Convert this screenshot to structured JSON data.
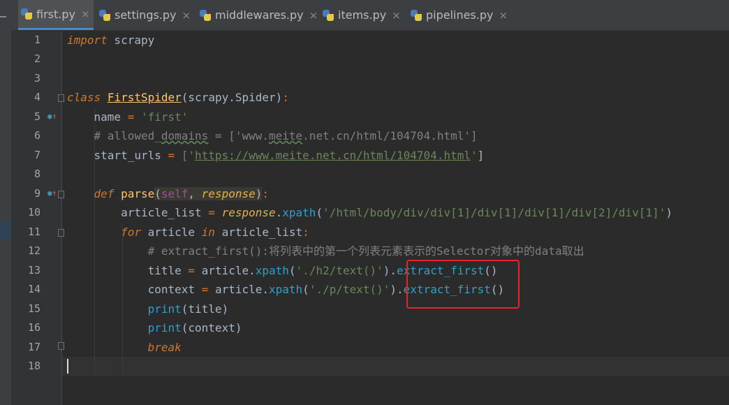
{
  "tabs": [
    {
      "label": "first.py",
      "active": true
    },
    {
      "label": "settings.py",
      "active": false
    },
    {
      "label": "middlewares.py",
      "active": false
    },
    {
      "label": "items.py",
      "active": false
    },
    {
      "label": "pipelines.py",
      "active": false
    }
  ],
  "close_glyph": "×",
  "line_numbers": [
    "1",
    "2",
    "3",
    "4",
    "5",
    "6",
    "7",
    "8",
    "9",
    "10",
    "11",
    "12",
    "13",
    "14",
    "15",
    "16",
    "17",
    "18"
  ],
  "current_line": 18,
  "colors": {
    "keyword": "#cc7832",
    "string": "#6a8759",
    "comment": "#808080",
    "highlight_box": "#e8242a",
    "method": "#2fa0c8"
  },
  "code": {
    "l1": {
      "kw": "import",
      "rest": " scrapy"
    },
    "l4": {
      "kw": "class",
      "name": "FirstSpider",
      "base": "(scrapy.Spider)",
      "colon": ":"
    },
    "l5": {
      "var": "name",
      "eq": " = ",
      "str": "'first'"
    },
    "l6": {
      "comment_pre": "# allowed_",
      "comment_wavy": "domains",
      "comment_mid": " = ['www.",
      "comment_wavy2": "meite",
      "comment_post": ".net.cn/html/104704.html']"
    },
    "l7": {
      "var": "start_urls",
      "eq": " = ",
      "open": "['",
      "url": "https://www.meite.net.cn/html/104704.html",
      "close_str": "'",
      "close": "]"
    },
    "l9": {
      "kw": "def",
      "name": " parse",
      "open": "(",
      "self": "self",
      "comma": ", ",
      "param": "response",
      "close": ")",
      "colon": ":"
    },
    "l10": {
      "var": "article_list",
      "eq": " = ",
      "obj": "response",
      "dot": ".",
      "meth": "xpath",
      "open": "(",
      "str": "'/html/body/div/div[1]/div[1]/div[1]/div[2]/div[1]'",
      "close": ")"
    },
    "l11": {
      "kw": "for",
      "var": " article ",
      "kw2": "in",
      "rest": " article_list",
      "colon": ":"
    },
    "l12": {
      "comment": "# extract_first():将列表中的第一个列表元素表示的Selector对象中的data取出"
    },
    "l13": {
      "var": "title",
      "eq": " = ",
      "obj": "article.",
      "meth": "xpath",
      "open": "(",
      "str": "'./h2/text()'",
      "close": ").",
      "meth2": "extract_first",
      "end": "()"
    },
    "l14": {
      "var": "context",
      "eq": " = ",
      "obj": "article.",
      "meth": "xpath",
      "open": "(",
      "str": "'./p/text()'",
      "close": ").",
      "meth2": "extract_first",
      "end": "()"
    },
    "l15": {
      "fn": "print",
      "args": "(title)"
    },
    "l16": {
      "fn": "print",
      "args": "(context)"
    },
    "l17": {
      "kw": "break"
    }
  }
}
